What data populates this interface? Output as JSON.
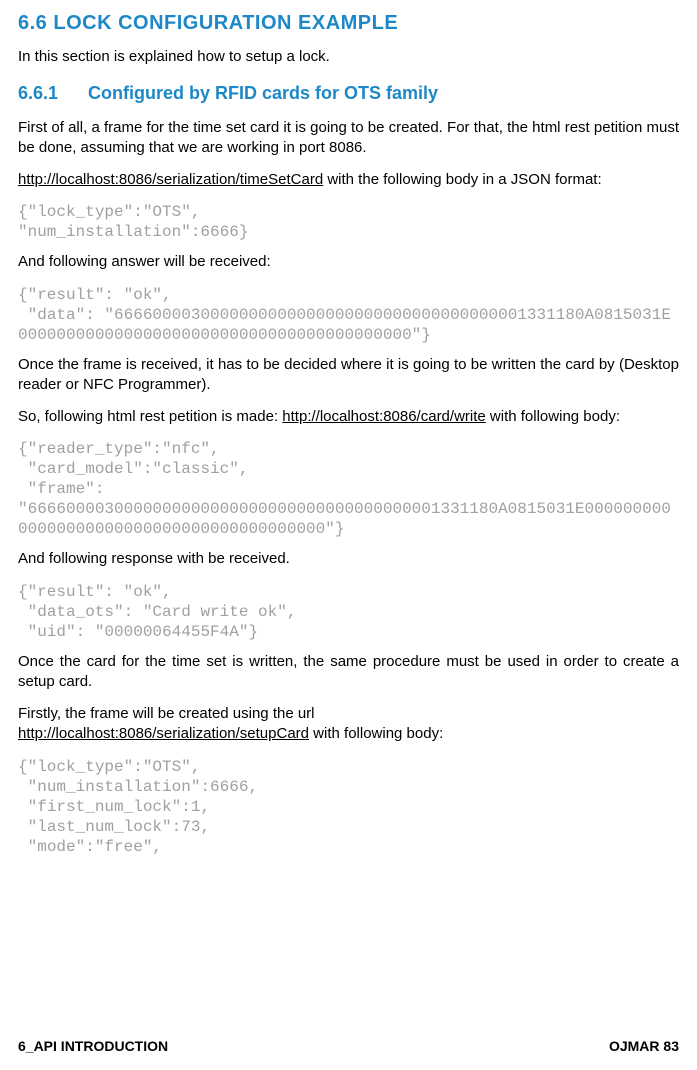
{
  "heading1": "6.6    LOCK CONFIGURATION EXAMPLE",
  "p1": "In this section is explained how to setup a lock.",
  "heading2_num": "6.6.1",
  "heading2_text": "Configured by RFID cards for OTS family",
  "p2": "First of all, a frame for the time set card it is going to be created. For that, the html rest petition must be done, assuming that we are working in port 8086.",
  "url1": "http://localhost:8086/serialization/timeSetCard",
  "p3_after": " with the following body in a JSON format:",
  "code1": "{\"lock_type\":\"OTS\",\n\"num_installation\":6666}",
  "p4": "And following answer will be received:",
  "code2": "{\"result\": \"ok\",\n \"data\": \"6666000030000000000000000000000000000000001331180A0815031E00000000000000000000000000000000000000000\"}",
  "p5": "Once the frame is received, it has to be decided where it is going to be written the card by (Desktop reader or NFC Programmer).",
  "p6_before": "So, following html rest petition is made: ",
  "url2": "http://localhost:8086/card/write",
  "p6_after": " with following body:",
  "code3": "{\"reader_type\":\"nfc\",\n \"card_model\":\"classic\",\n \"frame\":\n\"6666000030000000000000000000000000000000001331180A0815031E00000000000000000000000000000000000000000\"}",
  "p7": "And following response with be received.",
  "code4": "{\"result\": \"ok\",\n \"data_ots\": \"Card write ok\",\n \"uid\": \"00000064455F4A\"}",
  "p8": "Once the card for the time set is written, the same procedure must be used in order to create a setup card.",
  "p9_before": "Firstly, the frame will be created using the url",
  "url3": "http://localhost:8086/serialization/setupCard",
  "p9_after": " with following body:",
  "code5": "{\"lock_type\":\"OTS\",\n \"num_installation\":6666,\n \"first_num_lock\":1,\n \"last_num_lock\":73,\n \"mode\":\"free\",",
  "footer_left": "6_API INTRODUCTION",
  "footer_right": "OJMAR 83"
}
